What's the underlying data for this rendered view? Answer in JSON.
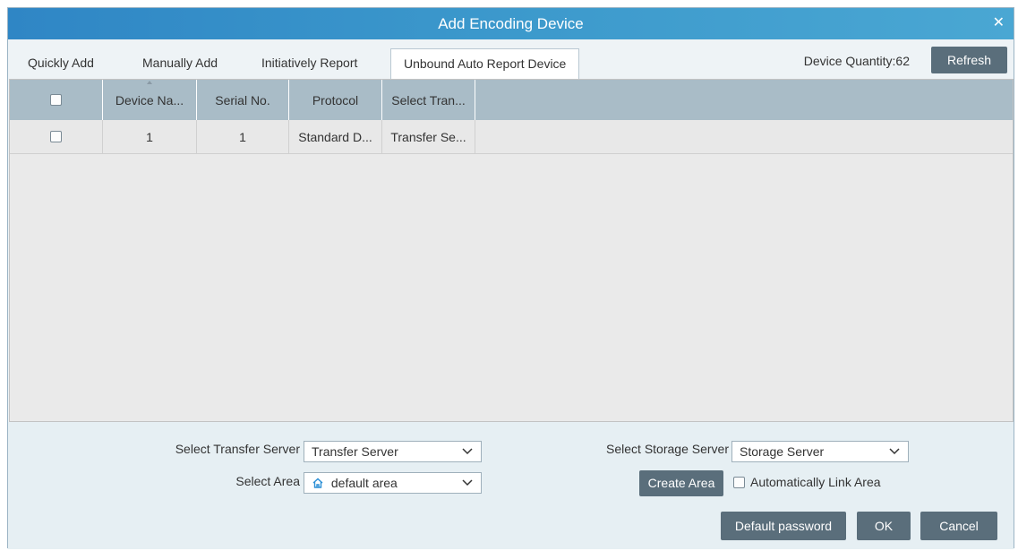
{
  "window": {
    "title": "Add Encoding Device",
    "close_glyph": "✕"
  },
  "tabs": [
    {
      "label": "Quickly Add",
      "active": false
    },
    {
      "label": "Manually Add",
      "active": false
    },
    {
      "label": "Initiatively Report",
      "active": false
    },
    {
      "label": "Unbound Auto Report Device",
      "active": true
    }
  ],
  "device_quantity": "Device Quantity:62",
  "refresh_label": "Refresh",
  "table": {
    "columns": [
      "Device Na...",
      "Serial No.",
      "Protocol",
      "Select Tran..."
    ],
    "rows": [
      {
        "checked": false,
        "cells": [
          "1",
          "1",
          "Standard D...",
          "Transfer Se..."
        ]
      }
    ]
  },
  "footer": {
    "transfer_server_label": "Select Transfer Server",
    "transfer_server_value": "Transfer Server",
    "storage_server_label": "Select Storage Server",
    "storage_server_value": "Storage Server",
    "area_label": "Select Area",
    "area_value": "default area",
    "create_area_label": "Create Area",
    "auto_link_label": "Automatically Link Area",
    "default_password_label": "Default password",
    "ok_label": "OK",
    "cancel_label": "Cancel"
  },
  "colors": {
    "titlebar": "#3c99cc",
    "header": "#a9bcc7",
    "button": "#5a6e7b",
    "footer": "#e6eff3"
  }
}
